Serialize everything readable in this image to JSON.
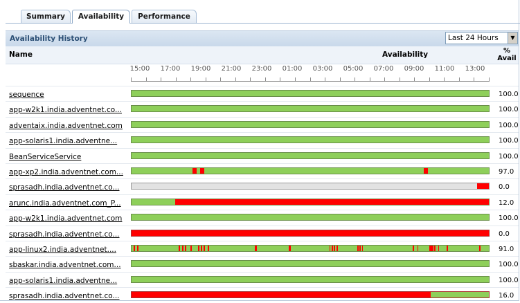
{
  "tabs": [
    {
      "label": "Summary",
      "active": false
    },
    {
      "label": "Availability",
      "active": true
    },
    {
      "label": "Performance",
      "active": false
    }
  ],
  "history": {
    "title": "Availability History",
    "period": "Last 24 Hours"
  },
  "columns": {
    "name": "Name",
    "availability": "Availability",
    "pct_line1": "%",
    "pct_line2": "Avail"
  },
  "time_labels": [
    "15:00",
    "17:00",
    "19:00",
    "21:00",
    "23:00",
    "01:00",
    "03:00",
    "05:00",
    "07:00",
    "09:00",
    "11:00",
    "13:00"
  ],
  "colors": {
    "up": "#8ecf5a",
    "down": "#ff0000",
    "unknown": "#e2e2e2"
  },
  "rows": [
    {
      "name": "sequence",
      "pct": "100.0",
      "base": "up",
      "down": []
    },
    {
      "name": "app-w2k1.india.adventnet.co...",
      "pct": "100.0",
      "base": "up",
      "down": []
    },
    {
      "name": "adventaix.india.adventnet.com",
      "pct": "100.0",
      "base": "up",
      "down": []
    },
    {
      "name": "app-solaris1.india.adventne...",
      "pct": "100.0",
      "base": "up",
      "down": []
    },
    {
      "name": "BeanServiceService",
      "pct": "100.0",
      "base": "up",
      "down": []
    },
    {
      "name": "app-xp2.india.adventnet.com...",
      "pct": "97.0",
      "base": "up",
      "down": [
        [
          0.171,
          0.183
        ],
        [
          0.192,
          0.204
        ],
        [
          0.818,
          0.83
        ]
      ]
    },
    {
      "name": "sprasadh.india.adventnet.co...",
      "pct": "0.0",
      "base": "unknown",
      "down": [
        [
          0.968,
          1.0
        ]
      ]
    },
    {
      "name": "arunc.india.adventnet.com_P...",
      "pct": "12.0",
      "base": "up",
      "down": [
        [
          0.122,
          1.0
        ]
      ]
    },
    {
      "name": "app-w2k1.india.adventnet.com",
      "pct": "100.0",
      "base": "up",
      "down": []
    },
    {
      "name": "sprasadh.india.adventnet.co...",
      "pct": "0.0",
      "base": "down",
      "down": []
    },
    {
      "name": "app-linux2.india.adventnet....",
      "pct": "91.0",
      "base": "up",
      "down": [
        [
          0.005,
          0.009
        ],
        [
          0.015,
          0.019
        ],
        [
          0.131,
          0.135
        ],
        [
          0.141,
          0.145
        ],
        [
          0.15,
          0.154
        ],
        [
          0.165,
          0.169
        ],
        [
          0.186,
          0.19
        ],
        [
          0.193,
          0.197
        ],
        [
          0.201,
          0.205
        ],
        [
          0.213,
          0.217
        ],
        [
          0.345,
          0.351
        ],
        [
          0.44,
          0.446
        ],
        [
          0.554,
          0.557
        ],
        [
          0.56,
          0.563
        ],
        [
          0.566,
          0.569
        ],
        [
          0.574,
          0.577
        ],
        [
          0.632,
          0.635
        ],
        [
          0.638,
          0.641
        ],
        [
          0.645,
          0.648
        ],
        [
          0.786,
          0.79
        ],
        [
          0.8,
          0.803
        ],
        [
          0.834,
          0.837
        ],
        [
          0.838,
          0.841
        ],
        [
          0.842,
          0.845
        ],
        [
          0.846,
          0.849
        ],
        [
          0.85,
          0.853
        ],
        [
          0.858,
          0.861
        ],
        [
          0.881,
          0.885
        ],
        [
          0.972,
          0.976
        ]
      ]
    },
    {
      "name": "sbaskar.india.adventnet.com...",
      "pct": "100.0",
      "base": "up",
      "down": []
    },
    {
      "name": "app-solaris1.india.adventne...",
      "pct": "100.0",
      "base": "up",
      "down": []
    },
    {
      "name": "sprasadh.india.adventnet.co...",
      "pct": "16.0",
      "base": "down",
      "up": [
        [
          0.838,
          1.0
        ]
      ]
    }
  ]
}
